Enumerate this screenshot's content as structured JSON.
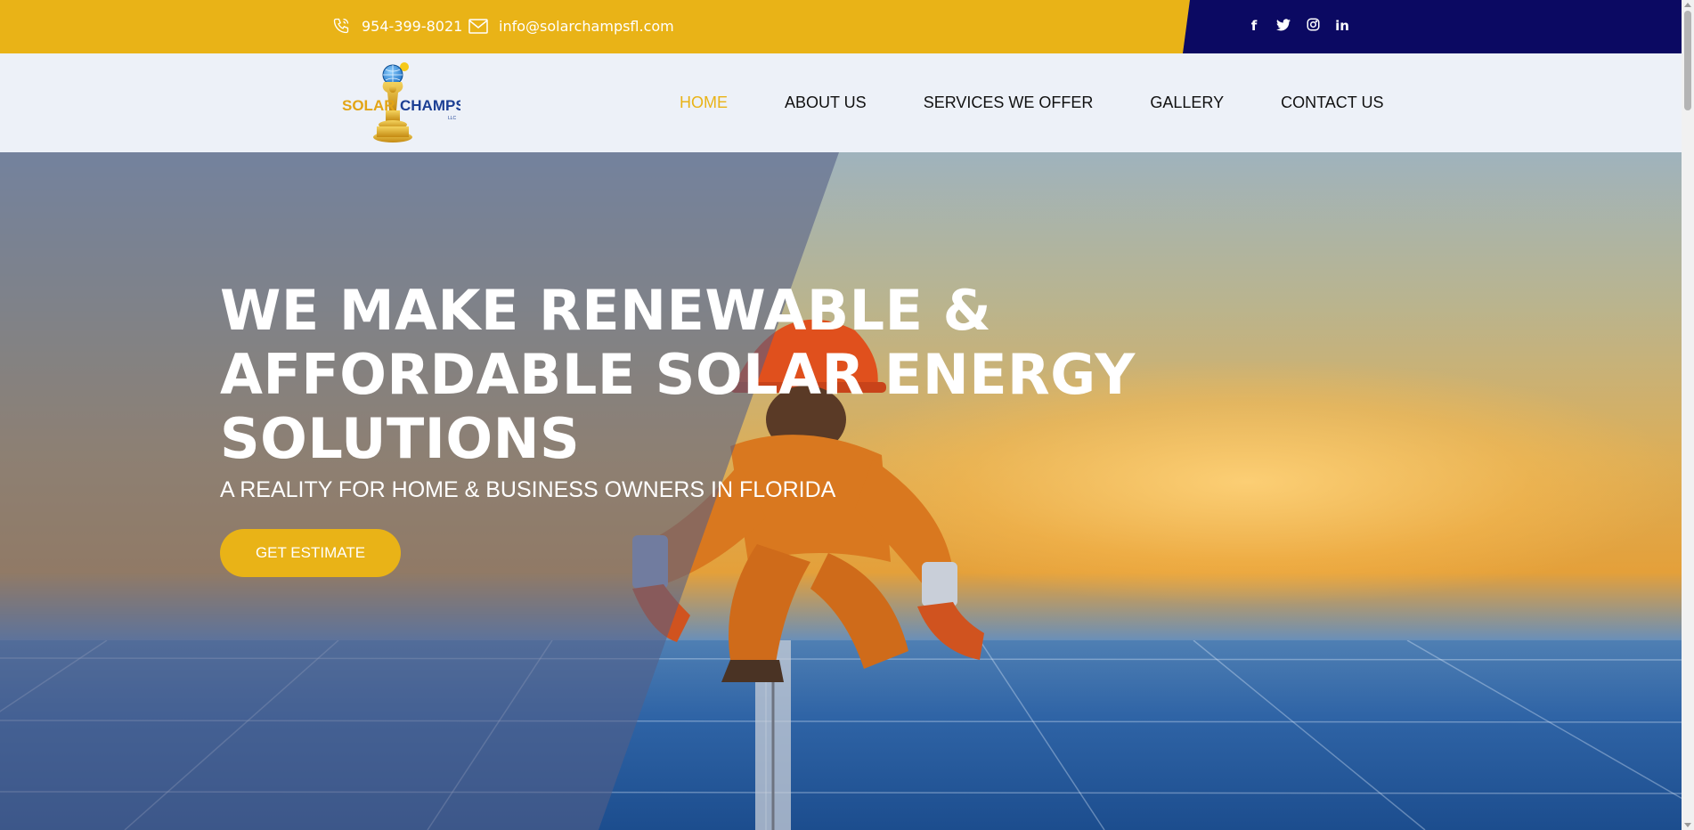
{
  "topbar": {
    "phone": "954-399-8021",
    "email": "info@solarchampsfl.com",
    "phone_icon": "phone-icon",
    "email_icon": "mail-icon",
    "socials": [
      {
        "name": "facebook-icon",
        "glyph": "f"
      },
      {
        "name": "twitter-icon",
        "glyph": "🐦"
      },
      {
        "name": "instagram-icon",
        "glyph": "◎"
      },
      {
        "name": "linkedin-icon",
        "glyph": "in"
      }
    ]
  },
  "logo": {
    "word_left": "SOLAR",
    "word_right": "CHAMPS",
    "suffix": "LLC"
  },
  "nav": {
    "items": [
      {
        "label": "HOME",
        "active": true
      },
      {
        "label": "ABOUT US",
        "active": false
      },
      {
        "label": "SERVICES WE OFFER",
        "active": false
      },
      {
        "label": "GALLERY",
        "active": false
      },
      {
        "label": "CONTACT US",
        "active": false
      }
    ]
  },
  "hero": {
    "title_line1": "WE MAKE RENEWABLE &",
    "title_line2": "AFFORDABLE SOLAR ENERGY",
    "title_line3": "SOLUTIONS",
    "subtitle": "A REALITY FOR HOME & BUSINESS OWNERS IN FLORIDA",
    "cta_label": "GET ESTIMATE"
  },
  "colors": {
    "accent": "#e9b317",
    "navy": "#0b0962",
    "nav_bg": "#edf1f8"
  }
}
